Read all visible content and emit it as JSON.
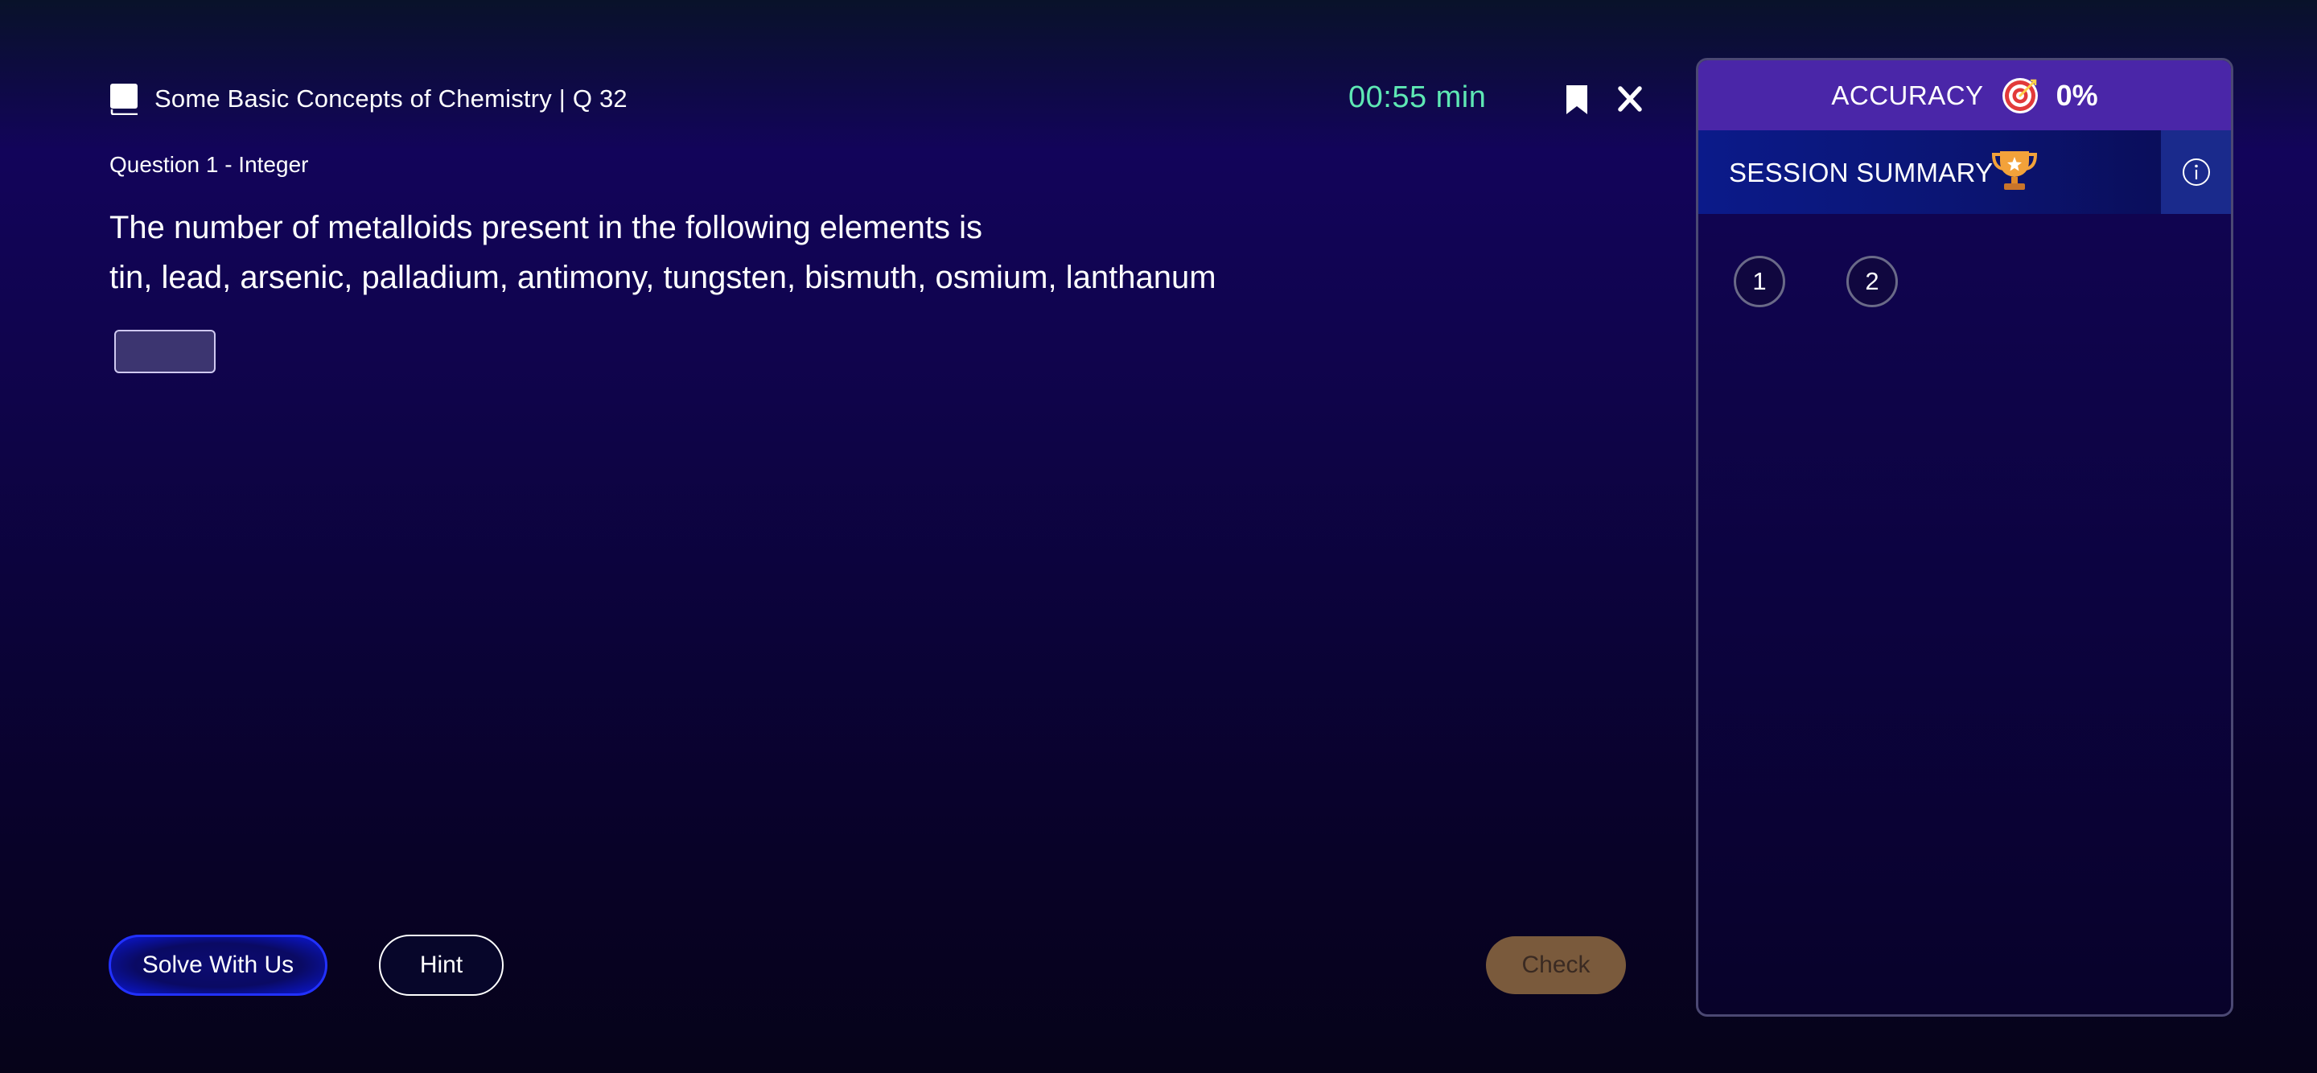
{
  "header": {
    "topic_title": "Some Basic Concepts of Chemistry | Q 32",
    "timer": "00:55 min",
    "timer_color": "#5ee8b4",
    "icons": {
      "topic": "book-icon",
      "bookmark": "bookmark-icon",
      "close": "close-icon"
    }
  },
  "question": {
    "type_label": "Question 1 - Integer",
    "text_line1": "The number of metalloids present in the following elements is",
    "text_line2": "tin, lead, arsenic, palladium, antimony, tungsten, bismuth, osmium, lanthanum",
    "answer_value": ""
  },
  "actions": {
    "solve_label": "Solve With Us",
    "hint_label": "Hint",
    "check_label": "Check"
  },
  "panel": {
    "accuracy_label": "ACCURACY",
    "accuracy_value": "0%",
    "summary_label": "SESSION SUMMARY",
    "question_numbers": [
      "1",
      "2"
    ],
    "icons": {
      "accuracy": "target-icon",
      "summary": "trophy-icon",
      "info": "info-icon"
    }
  },
  "colors": {
    "background": "#0b0339",
    "accuracy_bar": "#4a26a8",
    "check_button": "#7a5a3c",
    "solve_button_border": "#2231ff"
  }
}
